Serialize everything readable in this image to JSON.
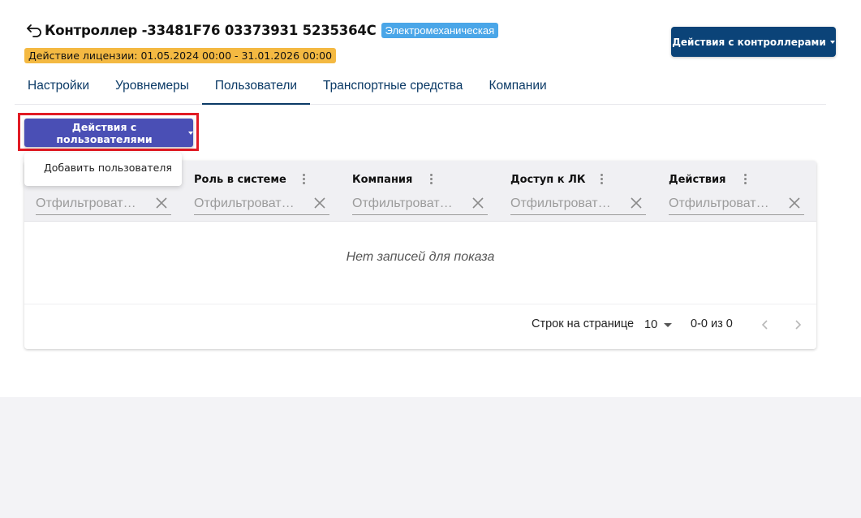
{
  "header": {
    "back_icon": "back-arrow-icon",
    "title": "Контроллер -33481F76 03373931 5235364C",
    "type_badge": "Электромеханическая",
    "type_badge_color": "#4aa6e8",
    "license": "Действие лицензии: 01.05.2024 00:00 - 31.01.2026 00:00",
    "license_color": "#f4b942",
    "controller_actions_label": "Действия с контроллерами",
    "controller_actions_color": "#0b4378"
  },
  "tabs": [
    {
      "label": "Настройки",
      "active": false
    },
    {
      "label": "Уровнемеры",
      "active": false
    },
    {
      "label": "Пользователи",
      "active": true
    },
    {
      "label": "Транспортные средства",
      "active": false
    },
    {
      "label": "Компании",
      "active": false
    }
  ],
  "users_actions": {
    "label": "Действия с пользователями",
    "color": "#4a4fb5",
    "highlight_color": "#e11b24",
    "menu_items": [
      {
        "label": "Добавить пользователя"
      }
    ]
  },
  "table": {
    "columns": [
      {
        "title": "",
        "filter_placeholder": "Отфильтроват…"
      },
      {
        "title": "Роль в системе",
        "filter_placeholder": "Отфильтроват…"
      },
      {
        "title": "Компания",
        "filter_placeholder": "Отфильтроват…"
      },
      {
        "title": "Доступ к ЛК",
        "filter_placeholder": "Отфильтроват…"
      },
      {
        "title": "Действия",
        "filter_placeholder": "Отфильтроват…"
      }
    ],
    "empty_message": "Нет записей для показа",
    "pagination": {
      "rows_per_page_label": "Строк на странице",
      "rows_per_page": "10",
      "range": "0-0 из 0"
    }
  }
}
